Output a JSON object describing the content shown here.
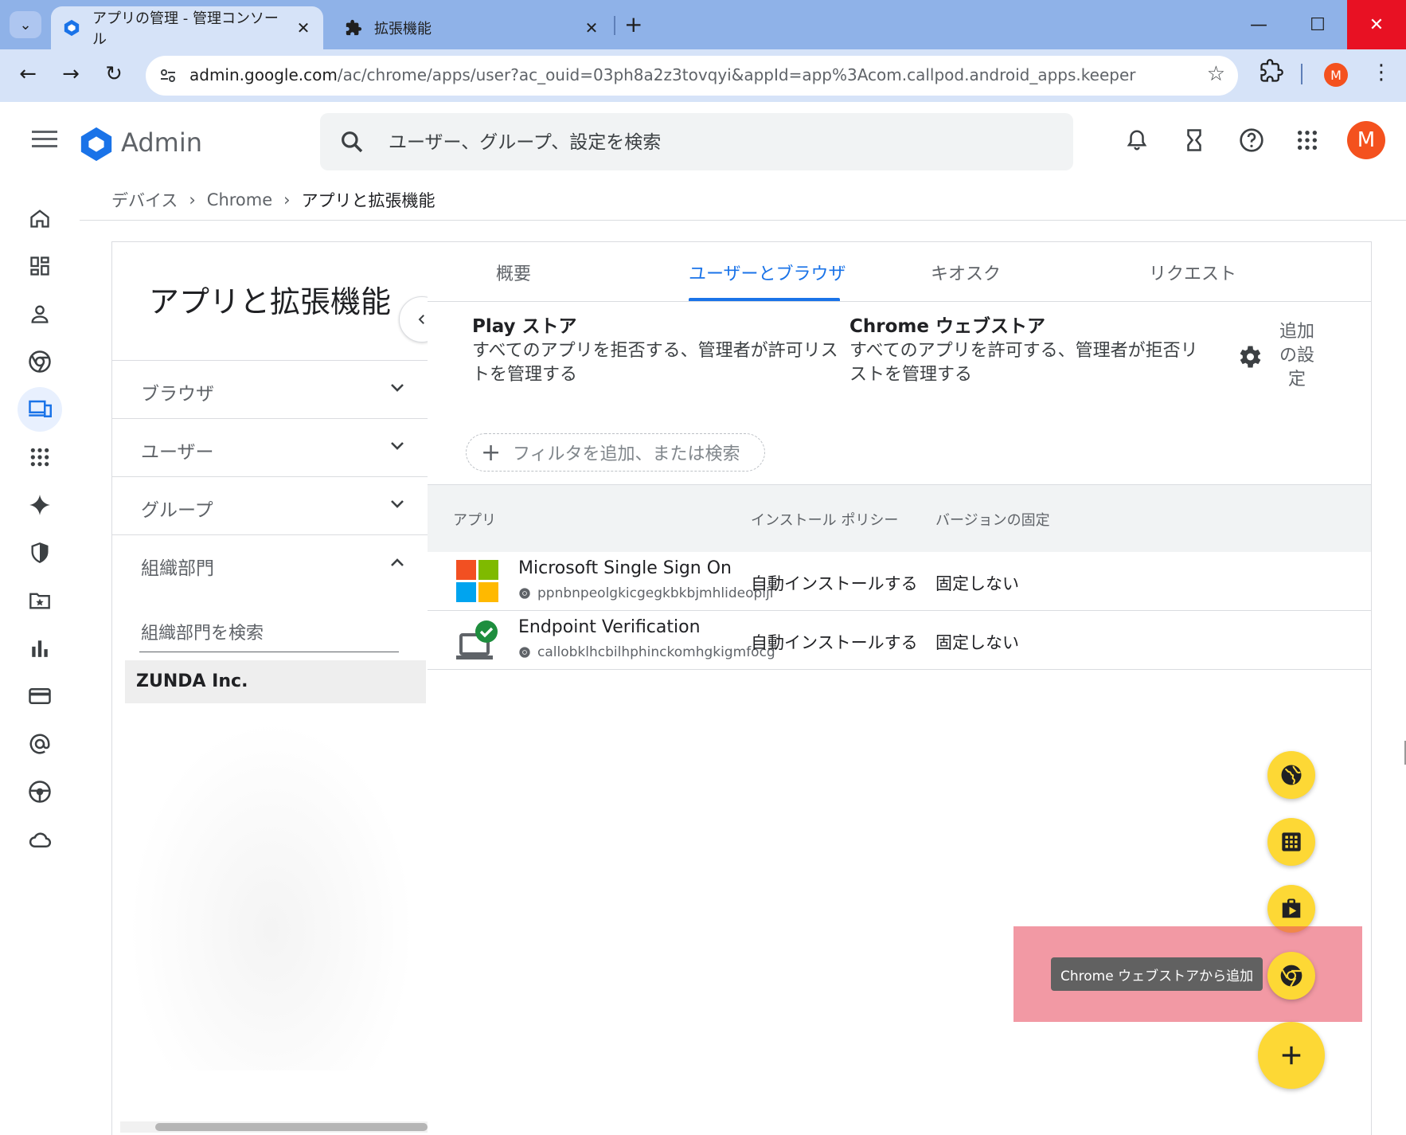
{
  "browser": {
    "tabs": [
      {
        "label": "アプリの管理 - 管理コンソール",
        "active": true
      },
      {
        "label": "拡張機能",
        "active": false
      }
    ],
    "url_host": "admin.google.com",
    "url_path": "/ac/chrome/apps/user?ac_ouid=03ph8a2z3tovqyi&appId=app%3Acom.callpod.android_apps.keeper",
    "profile_initial": "M"
  },
  "header": {
    "logo_text": "Admin",
    "search_placeholder": "ユーザー、グループ、設定を検索",
    "avatar_initial": "M"
  },
  "breadcrumb": [
    "デバイス",
    "Chrome",
    "アプリと拡張機能"
  ],
  "left_panel": {
    "title": "アプリと拡張機能",
    "sections": [
      {
        "label": "ブラウザ",
        "expanded": false
      },
      {
        "label": "ユーザー",
        "expanded": false
      },
      {
        "label": "グループ",
        "expanded": false
      },
      {
        "label": "組織部門",
        "expanded": true
      }
    ],
    "org_search_placeholder": "組織部門を検索",
    "org_name": "ZUNDA Inc."
  },
  "tabs": [
    "概要",
    "ユーザーとブラウザ",
    "キオスク",
    "リクエスト"
  ],
  "active_tab": "ユーザーとブラウザ",
  "stores": [
    {
      "title": "Play ストア",
      "desc": "すべてのアプリを拒否する、管理者が許可リストを管理する"
    },
    {
      "title": "Chrome ウェブストア",
      "desc": "すべてのアプリを許可する、管理者が拒否リストを管理する"
    }
  ],
  "additional_settings": "追加の設定",
  "filter_label": "フィルタを追加、または検索",
  "table": {
    "headers": [
      "アプリ",
      "インストール ポリシー",
      "バージョンの固定"
    ],
    "rows": [
      {
        "name": "Microsoft Single Sign On",
        "id": "ppnbnpeolgkicgegkbkbjmhlideopiji",
        "policy": "自動インストールする",
        "pin": "固定しない",
        "icon": "microsoft-logo"
      },
      {
        "name": "Endpoint Verification",
        "id": "callobklhcbilhphinckomhgkigmfocg",
        "policy": "自動インストールする",
        "pin": "固定しない",
        "icon": "endpoint-verification-logo"
      }
    ]
  },
  "fab": {
    "tooltip": "Chrome ウェブストアから追加",
    "actions": [
      "globe-icon",
      "apps-grid-icon",
      "play-store-icon",
      "chrome-icon"
    ]
  },
  "colors": {
    "accent": "#1a73e8",
    "fab": "#fdd835",
    "highlight": "#e8465a",
    "avatar": "#f4511e"
  }
}
